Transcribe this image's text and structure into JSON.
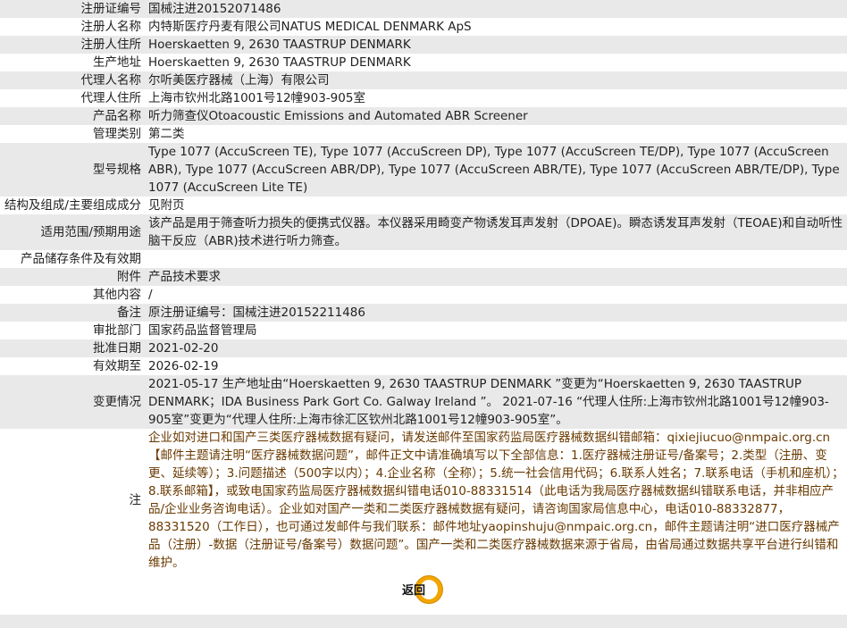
{
  "rows": [
    {
      "label": "注册证编号",
      "value": "国械注进20152071486"
    },
    {
      "label": "注册人名称",
      "value": "内特斯医疗丹麦有限公司NATUS MEDICAL DENMARK ApS"
    },
    {
      "label": "注册人住所",
      "value": "Hoerskaetten 9, 2630 TAASTRUP DENMARK"
    },
    {
      "label": "生产地址",
      "value": "Hoerskaetten 9, 2630 TAASTRUP DENMARK"
    },
    {
      "label": "代理人名称",
      "value": "尔听美医疗器械（上海）有限公司"
    },
    {
      "label": "代理人住所",
      "value": "上海市钦州北路1001号12幢903-905室"
    },
    {
      "label": "产品名称",
      "value": "听力筛查仪Otoacoustic Emissions and Automated ABR Screener"
    },
    {
      "label": "管理类别",
      "value": "第二类"
    },
    {
      "label": "型号规格",
      "value": "Type 1077 (AccuScreen TE), Type 1077 (AccuScreen DP), Type 1077 (AccuScreen TE/DP), Type 1077 (AccuScreen ABR), Type 1077 (AccuScreen ABR/DP), Type 1077 (AccuScreen ABR/TE), Type 1077 (AccuScreen ABR/TE/DP), Type 1077 (AccuScreen Lite TE)"
    },
    {
      "label": "结构及组成/主要组成成分",
      "value": "见附页"
    },
    {
      "label": "适用范围/预期用途",
      "value": "该产品是用于筛查听力损失的便携式仪器。本仪器采用畸变产物诱发耳声发射（DPOAE)。瞬态诱发耳声发射（TEOAE)和自动听性脑干反应（ABR)技术进行听力筛查。"
    },
    {
      "label": "产品储存条件及有效期",
      "value": ""
    },
    {
      "label": "附件",
      "value": "产品技术要求"
    },
    {
      "label": "其他内容",
      "value": "/"
    },
    {
      "label": "备注",
      "value": "原注册证编号：国械注进20152211486"
    },
    {
      "label": "审批部门",
      "value": "国家药品监督管理局"
    },
    {
      "label": "批准日期",
      "value": "2021-02-20"
    },
    {
      "label": "有效期至",
      "value": "2026-02-19"
    },
    {
      "label": "变更情况",
      "value": "2021-05-17 生产地址由“Hoerskaetten 9, 2630 TAASTRUP DENMARK ”变更为“Hoerskaetten 9, 2630 TAASTRUP DENMARK；IDA Business Park Gort Co. Galway Ireland ”。 2021-07-16 “代理人住所:上海市钦州北路1001号12幢903-905室”变更为“代理人住所:上海市徐汇区钦州北路1001号12幢903-905室”。"
    },
    {
      "label": "注",
      "value": "企业如对进口和国产三类医疗器械数据有疑问，请发送邮件至国家药监局医疗器械数据纠错邮箱：qixiejiucuo@nmpaic.org.cn【邮件主题请注明“医疗器械数据问题”，邮件正文中请准确填写以下全部信息：1.医疗器械注册证号/备案号；2.类型（注册、变更、延续等）；3.问题描述（500字以内）；4.企业名称（全称）；5.统一社会信用代码；6.联系人姓名；7.联系电话（手机和座机）；8.联系邮箱】，或致电国家药监局医疗器械数据纠错电话010-88331514（此电话为我局医疗器械数据纠错联系电话，并非相应产品/企业业务咨询电话）。企业如对国产一类和二类医疗器械数据有疑问，请咨询国家局信息中心，电话010-88332877，88331520（工作日），也可通过发邮件与我们联系：邮件地址yaopinshuju@nmpaic.org.cn，邮件主题请注明“进口医疗器械产品（注册）-数据（注册证号/备案号）数据问题”。国产一类和二类医疗器械数据来源于省局，由省局通过数据共享平台进行纠错和维护。"
    }
  ],
  "back_button": {
    "label": "返回"
  },
  "colors": {
    "row_shade": "#e9e9e9",
    "notice_text": "#6a3a00",
    "button_ring": "#f2a600"
  }
}
